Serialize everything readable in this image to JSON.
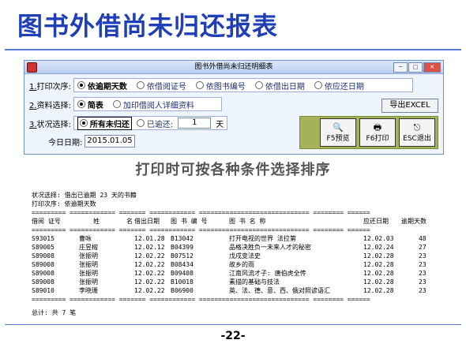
{
  "slide": {
    "title": "图书外借尚未归还报表",
    "caption": "打印时可按各种条件选择排序",
    "page_number": "-22-"
  },
  "window": {
    "title": "图书外借尚未归还明细表",
    "controls": [
      "minimize",
      "maximize",
      "close"
    ],
    "print_order": {
      "label_num": "1.",
      "label": "打印次序:",
      "options": [
        "依逾期天数",
        "依借阅证号",
        "依图书编号",
        "依借出日期",
        "依应还日期"
      ],
      "selected": "依逾期天数"
    },
    "data_select": {
      "label_num": "2.",
      "label": "资料选择:",
      "options": [
        "简表",
        "加印借阅人详细资料"
      ],
      "selected": "简表"
    },
    "status_select": {
      "label_num": "3.",
      "label": "状况选择:",
      "options": [
        "所有未归还",
        "已逾还:"
      ],
      "selected": "所有未归还",
      "days_value": "1",
      "days_unit": "天"
    },
    "today": {
      "label": "今日日期:",
      "value": "2015.01.05"
    },
    "buttons": {
      "export_excel": "导出EXCEL",
      "preview": "F5预览",
      "print": "F6打印",
      "exit": "ESC退出"
    },
    "accent_color": "#1f3fb8",
    "panel_color": "#a6b25a"
  },
  "report": {
    "status_line": "状况选择: 借出已逾期 23 天的书籍",
    "order_line": "打印次序: 依逾期天数",
    "separator": "========= ============ ======= ============ ============================= ======== ======",
    "headers": [
      "借阅 证号",
      "姓",
      "名",
      "借出日期",
      "图 书 编 号",
      "图 书 名 称",
      "应还日期",
      "逾期天数"
    ],
    "rows": [
      [
        "S93015",
        "曹咏",
        "12.01.28",
        "B13042",
        "打开电视的世界 法拉第",
        "12.02.03",
        "48"
      ],
      [
        "S89005",
        "庄昱榕",
        "12.02.12",
        "B04399",
        "品格决胜负一未来人才的秘密",
        "12.02.24",
        "27"
      ],
      [
        "S89008",
        "张振明",
        "12.02.22",
        "B07512",
        "戊戌变法史",
        "12.02.28",
        "23"
      ],
      [
        "S89008",
        "张振明",
        "12.02.22",
        "B08434",
        "故乡的雨",
        "12.02.28",
        "23"
      ],
      [
        "S89008",
        "张振明",
        "12.02.22",
        "B09408",
        "江南风流才子: 唐伯虎全传",
        "12.02.28",
        "23"
      ],
      [
        "S89008",
        "张振明",
        "12.02.22",
        "B10018",
        "素描的基础与技法",
        "12.02.28",
        "23"
      ],
      [
        "S89010",
        "李晓珊",
        "12.02.22",
        "B06900",
        "英、法、德、意、西、俄对照谚语汇",
        "12.02.28",
        "23"
      ]
    ],
    "total": "总计: 共 7 笔"
  }
}
